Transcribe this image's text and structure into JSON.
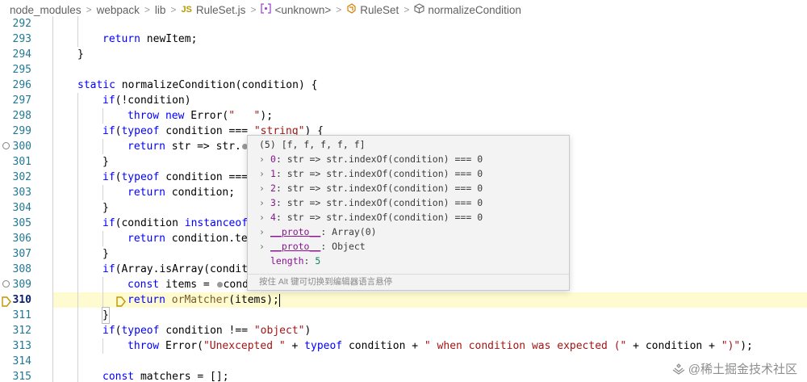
{
  "breadcrumb": {
    "items": [
      "node_modules",
      "webpack",
      "lib",
      "RuleSet.js",
      "<unknown>",
      "RuleSet",
      "normalizeCondition"
    ],
    "js_badge": "JS",
    "separator": ">"
  },
  "lines": [
    {
      "n": "292",
      "code": ""
    },
    {
      "n": "293",
      "code": "return newItem;"
    },
    {
      "n": "294",
      "code": "}"
    },
    {
      "n": "295",
      "code": ""
    },
    {
      "n": "296",
      "code": "static normalizeCondition(condition) {"
    },
    {
      "n": "297",
      "code": "if(!condition)"
    },
    {
      "n": "298",
      "code": "throw new Error(\"   \");"
    },
    {
      "n": "299",
      "code": "if(typeof condition === \"string\") {"
    },
    {
      "n": "300",
      "code": "return str => str."
    },
    {
      "n": "301",
      "code": "}"
    },
    {
      "n": "302",
      "code": "if(typeof condition ==="
    },
    {
      "n": "303",
      "code": "return condition;"
    },
    {
      "n": "304",
      "code": "}"
    },
    {
      "n": "305",
      "code": "if(condition instanceof"
    },
    {
      "n": "306",
      "code": "return condition.te"
    },
    {
      "n": "307",
      "code": "}"
    },
    {
      "n": "308",
      "code": "if(Array.isArray(condit"
    },
    {
      "n": "309",
      "code": "const items = "
    },
    {
      "n": "310",
      "code": "return orMatcher(items);"
    },
    {
      "n": "311",
      "code": "}"
    },
    {
      "n": "312",
      "code": "if(typeof condition !== \"object\")"
    },
    {
      "n": "313",
      "code": "throw Error(\"Unexcepted \" + typeof condition + \" when condition was expected (\" + condition + \")\");"
    },
    {
      "n": "314",
      "code": ""
    },
    {
      "n": "315",
      "code": "const matchers = [];"
    }
  ],
  "code_tail_309": "cond",
  "hover": {
    "title": "(5) [f, f, f, f, f]",
    "entries": [
      {
        "key": "0",
        "value": "str => str.indexOf(condition) === 0"
      },
      {
        "key": "1",
        "value": "str => str.indexOf(condition) === 0"
      },
      {
        "key": "2",
        "value": "str => str.indexOf(condition) === 0"
      },
      {
        "key": "3",
        "value": "str => str.indexOf(condition) === 0"
      },
      {
        "key": "4",
        "value": "str => str.indexOf(condition) === 0"
      }
    ],
    "proto1_key": "__proto__",
    "proto1_value": "Array(0)",
    "proto2_key": "__proto__",
    "proto2_value": "Object",
    "length_key": "length",
    "length_value": "5",
    "footer": "按住 Alt 键可切换到编辑器语言悬停"
  },
  "watermark": "@稀土掘金技术社区",
  "colors": {
    "line_number": "#237893",
    "keyword": "#0000ff",
    "string": "#a31515",
    "current_line_bg": "#fffbd0",
    "breakpoint_arrow": "#c09400"
  },
  "icons": {
    "js_file": "js-file-icon",
    "symbol": "symbol-bracket-icon",
    "class": "class-icon",
    "method": "method-cube-icon",
    "breakpoint": "breakpoint-circle-icon",
    "current_frame": "current-frame-arrow-icon",
    "expand": "chevron-right-icon"
  }
}
